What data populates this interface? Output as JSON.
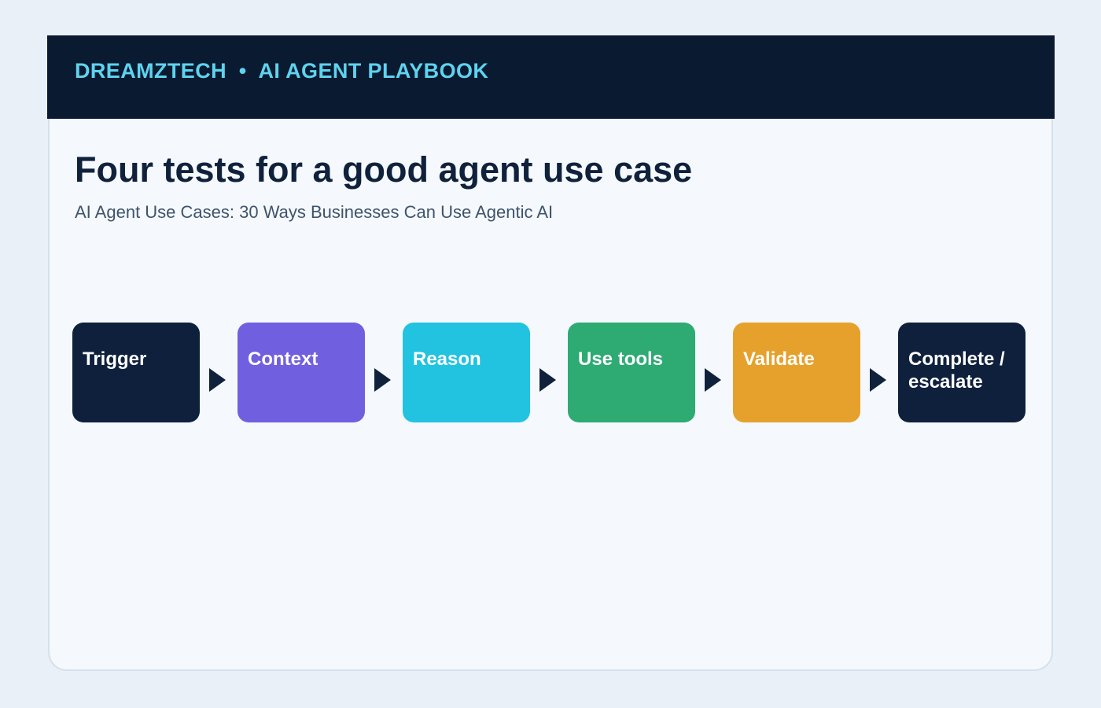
{
  "header": {
    "brand": "DREAMZTECH  •  AI AGENT PLAYBOOK"
  },
  "main": {
    "title": "Four tests for a good agent use case",
    "subtitle": "AI Agent Use Cases: 30 Ways Businesses Can Use Agentic AI"
  },
  "flow": {
    "steps": [
      {
        "label": "Trigger",
        "color": "#0e203c"
      },
      {
        "label": "Context",
        "color": "#7060e0"
      },
      {
        "label": "Reason",
        "color": "#22c3e0"
      },
      {
        "label": "Use tools",
        "color": "#2eaa73"
      },
      {
        "label": "Validate",
        "color": "#e6a12d"
      },
      {
        "label": "Complete / escalate",
        "color": "#0e203c"
      }
    ],
    "arrow_color": "#10213b",
    "arrow_icon": "triangle-right-icon"
  }
}
